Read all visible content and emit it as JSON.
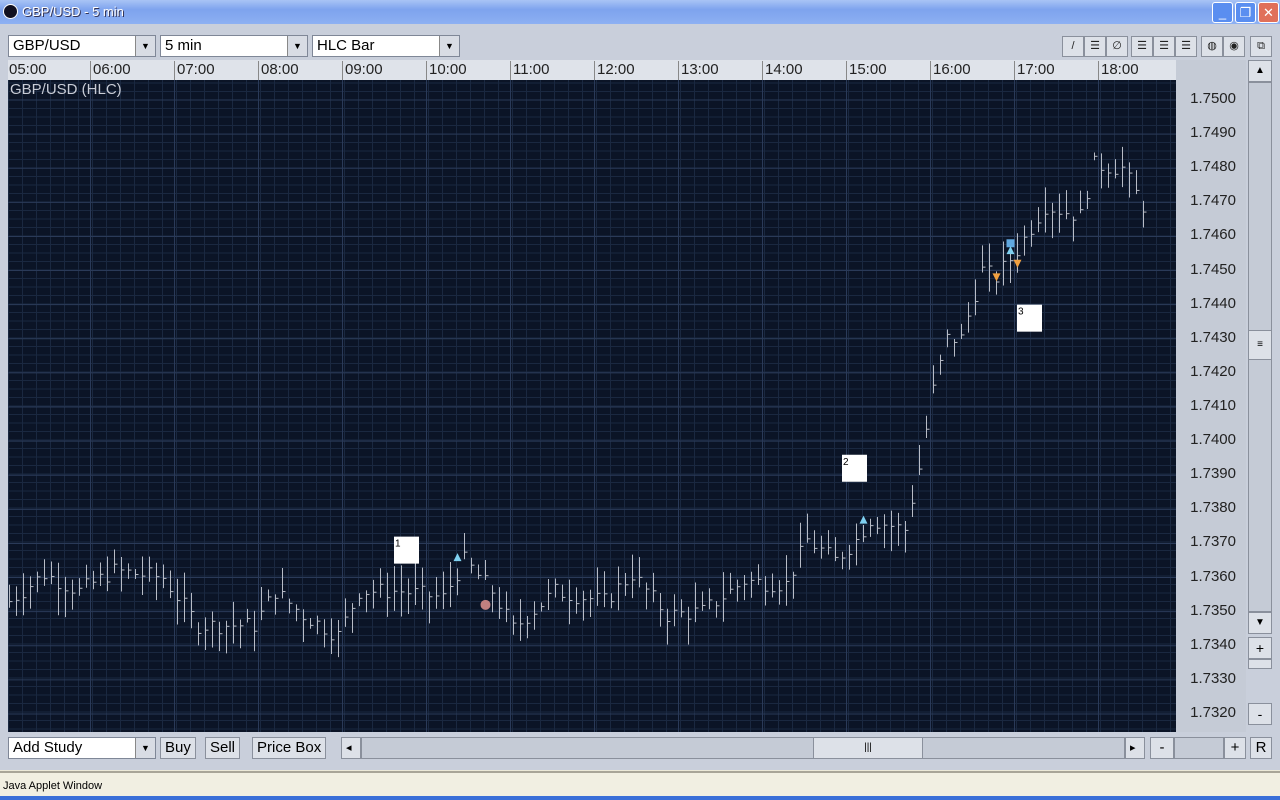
{
  "window": {
    "title": "GBP/USD - 5 min",
    "minimize": "_",
    "restore": "❐",
    "close": "✕"
  },
  "toolbar": {
    "symbol": "GBP/USD",
    "interval": "5 min",
    "chart_type": "HLC Bar",
    "tools": [
      {
        "icon": "trend-line-icon",
        "g": "/"
      },
      {
        "icon": "horizontal-lines-icon",
        "g": "☰"
      },
      {
        "icon": "no-draw-icon",
        "g": "∅"
      },
      {
        "icon": "fib-lines-icon",
        "g": "☰"
      },
      {
        "icon": "channel-lines-icon",
        "g": "☰"
      },
      {
        "icon": "gann-lines-icon",
        "g": "☰"
      },
      {
        "icon": "circle-hatch-icon",
        "g": "◍"
      },
      {
        "icon": "circle-fill-icon",
        "g": "◉"
      }
    ],
    "detach": "⧉"
  },
  "bottom": {
    "add_study": "Add Study",
    "buy": "Buy",
    "sell": "Sell",
    "price_box": "Price Box",
    "left": "◂",
    "right": "▸",
    "thumb": "|||",
    "minus": "-",
    "plus": "+",
    "reset": "R"
  },
  "vscroll": {
    "up": "▲",
    "down": "▼",
    "thumb": "≡",
    "plus": "+",
    "minus": "-"
  },
  "status": "Java Applet Window",
  "chart_data": {
    "type": "hlc-bar",
    "title": "GBP/USD (HLC)",
    "bar_minutes": 5,
    "x_ticks": [
      "05:00",
      "06:00",
      "07:00",
      "08:00",
      "09:00",
      "10:00",
      "11:00",
      "12:00",
      "13:00",
      "14:00",
      "15:00",
      "16:00",
      "17:00",
      "18:00"
    ],
    "y_ticks": [
      "1.7500",
      "1.7490",
      "1.7480",
      "1.7470",
      "1.7460",
      "1.7450",
      "1.7440",
      "1.7430",
      "1.7420",
      "1.7410",
      "1.7400",
      "1.7390",
      "1.7380",
      "1.7370",
      "1.7360",
      "1.7350",
      "1.7340",
      "1.7330",
      "1.7320"
    ],
    "ylim": [
      1.7316,
      1.7505
    ],
    "close_path": [
      [
        0,
        1.7353
      ],
      [
        5,
        1.7361
      ],
      [
        10,
        1.7356
      ],
      [
        15,
        1.7362
      ],
      [
        22,
        1.736
      ],
      [
        27,
        1.7346
      ],
      [
        35,
        1.7346
      ],
      [
        38,
        1.7356
      ],
      [
        42,
        1.7349
      ],
      [
        47,
        1.7343
      ],
      [
        50,
        1.7356
      ],
      [
        56,
        1.7356
      ],
      [
        62,
        1.7354
      ],
      [
        65,
        1.7365
      ],
      [
        69,
        1.7356
      ],
      [
        72,
        1.7345
      ],
      [
        78,
        1.7356
      ],
      [
        85,
        1.7353
      ],
      [
        89,
        1.7361
      ],
      [
        94,
        1.7349
      ],
      [
        99,
        1.735
      ],
      [
        105,
        1.7359
      ],
      [
        111,
        1.7358
      ],
      [
        114,
        1.7371
      ],
      [
        118,
        1.7365
      ],
      [
        121,
        1.7371
      ],
      [
        123,
        1.7377
      ],
      [
        128,
        1.7374
      ],
      [
        130,
        1.7392
      ],
      [
        132,
        1.7415
      ],
      [
        134,
        1.743
      ],
      [
        136,
        1.743
      ],
      [
        139,
        1.745
      ],
      [
        141,
        1.7448
      ],
      [
        144,
        1.7456
      ],
      [
        147,
        1.7466
      ],
      [
        148,
        1.7469
      ],
      [
        153,
        1.7466
      ],
      [
        155,
        1.7481
      ],
      [
        159,
        1.748
      ],
      [
        162,
        1.7469
      ]
    ],
    "markers": [
      {
        "type": "buy-triangle",
        "bar": 64,
        "price": 1.7366
      },
      {
        "type": "exit-circle",
        "bar": 68,
        "price": 1.7352
      },
      {
        "type": "buy-triangle",
        "bar": 122,
        "price": 1.7377
      },
      {
        "type": "stop-square",
        "bar": 143,
        "price": 1.7458
      },
      {
        "type": "buy-triangle",
        "bar": 143,
        "price": 1.7456
      },
      {
        "type": "sell-triangle",
        "bar": 141,
        "price": 1.7448
      },
      {
        "type": "sell-triangle",
        "bar": 144,
        "price": 1.7452
      }
    ],
    "labels": [
      {
        "text": "1",
        "bar": 55,
        "price": 1.7372
      },
      {
        "text": "2",
        "bar": 119,
        "price": 1.7396
      },
      {
        "text": "3",
        "bar": 144,
        "price": 1.744
      }
    ]
  }
}
